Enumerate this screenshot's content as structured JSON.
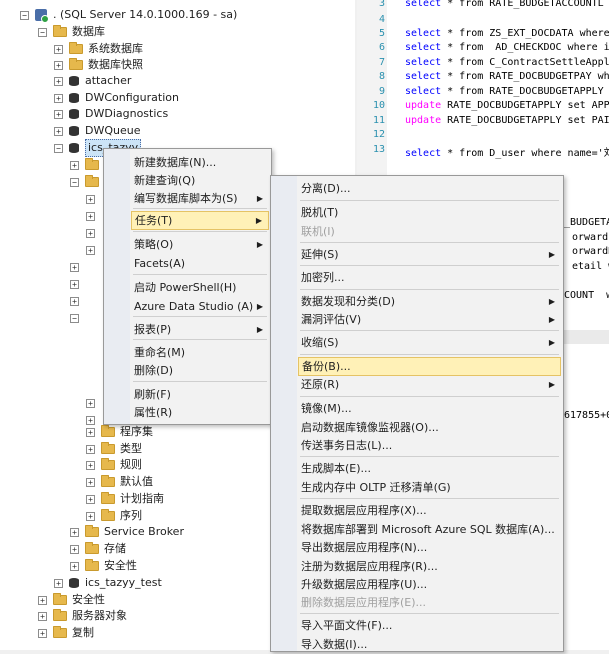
{
  "explorer": {
    "server": ". (SQL Server 14.0.1000.169 - sa)",
    "databases": "数据库",
    "system_dbs": "系统数据库",
    "snapshots": "数据库快照",
    "db_attacher": "attacher",
    "db_dwconfig": "DWConfiguration",
    "db_dwdiag": "DWDiagnostics",
    "db_dwqueue": "DWQueue",
    "db_selected": "ics_tazyy",
    "f_assemblies": "程序集",
    "f_types": "类型",
    "f_rules": "规则",
    "f_defaults": "默认值",
    "f_planguides": "计划指南",
    "f_sequences": "序列",
    "f_broker": "Service Broker",
    "f_storage": "存储",
    "f_security": "安全性",
    "db_test": "ics_tazyy_test",
    "security": "安全性",
    "server_objects": "服务器对象",
    "replication": "复制"
  },
  "editor": {
    "lines": [
      {
        "n": "3",
        "kw": "select",
        "rest": " * from RATE_BUDGETACCOUNTL where"
      },
      {
        "n": "4",
        "kw": "",
        "rest": ""
      },
      {
        "n": "5",
        "kw": "select",
        "rest": " * from ZS_EXT_DOCDATA where"
      },
      {
        "n": "6",
        "kw": "select",
        "rest": " * from  AD_CHECKDOC where id"
      },
      {
        "n": "7",
        "kw": "select",
        "rest": " * from C_ContractSettleApply"
      },
      {
        "n": "8",
        "kw": "select",
        "rest": " * from RATE_DOCBUDGETPAY whe"
      },
      {
        "n": "9",
        "kw": "select",
        "rest": " * from RATE_DOCBUDGETAPPLY w"
      },
      {
        "n": "10",
        "kw": "update",
        "rest": " RATE_DOCBUDGETAPPLY set APPL"
      },
      {
        "n": "11",
        "kw": "update",
        "rest": " RATE_DOCBUDGETAPPLY set PAID"
      },
      {
        "n": "12",
        "kw": "",
        "rest": ""
      },
      {
        "n": "13",
        "kw": "select",
        "rest": " * from D_user where name='刘"
      }
    ],
    "frag1": "_BUDGETACC",
    "frag2": "orward wh",
    "frag3": "orwardDet",
    "frag4": "etail whe",
    "frag5": "COUNT  w",
    "frag6": "617855+0"
  },
  "menu1": {
    "items": [
      "新建数据库(N)...",
      "新建查询(Q)",
      "编写数据库脚本为(S)",
      "任务(T)",
      "策略(O)",
      "Facets(A)",
      "启动 PowerShell(H)",
      "Azure Data Studio (A)",
      "报表(P)",
      "重命名(M)",
      "删除(D)",
      "刷新(F)",
      "属性(R)"
    ]
  },
  "menu2": {
    "items": [
      "分离(D)...",
      "脱机(T)",
      "联机(I)",
      "延伸(S)",
      "加密列...",
      "数据发现和分类(D)",
      "漏洞评估(V)",
      "收缩(S)",
      "备份(B)...",
      "还原(R)",
      "镜像(M)...",
      "启动数据库镜像监视器(O)...",
      "传送事务日志(L)...",
      "生成脚本(E)...",
      "生成内存中 OLTP 迁移清单(G)",
      "提取数据层应用程序(X)...",
      "将数据库部署到 Microsoft Azure SQL 数据库(A)...",
      "导出数据层应用程序(N)...",
      "注册为数据层应用程序(R)...",
      "升级数据层应用程序(U)...",
      "删除数据层应用程序(E)...",
      "导入平面文件(F)...",
      "导入数据(I)..."
    ]
  },
  "arrow": "▶",
  "expand_plus": "+",
  "expand_minus": "−"
}
